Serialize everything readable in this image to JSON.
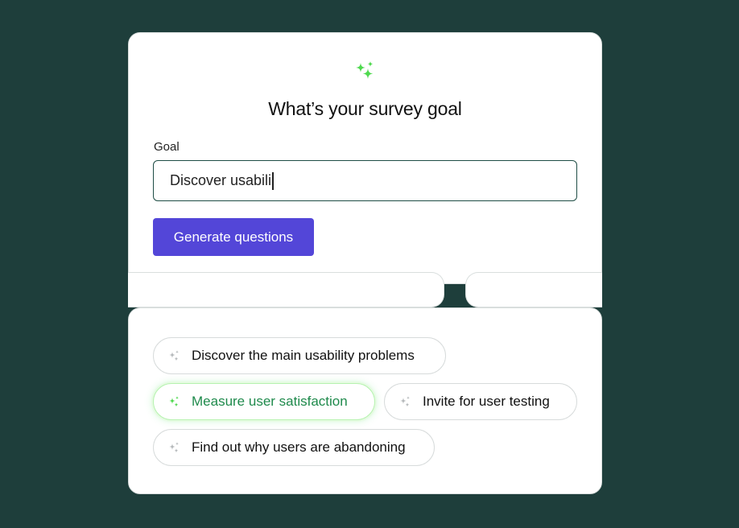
{
  "goal_card": {
    "icon": "sparkles-icon",
    "title": "What’s your survey goal",
    "field_label": "Goal",
    "input_value": "Discover usabili",
    "generate_button": "Generate questions"
  },
  "suggestions": {
    "items": [
      {
        "label": "Discover the main usability problems",
        "icon": "sparkle-icon",
        "active": false
      },
      {
        "label": "Measure user satisfaction",
        "icon": "sparkle-icon",
        "active": true
      },
      {
        "label": "Invite for user testing",
        "icon": "sparkle-icon",
        "active": false
      },
      {
        "label": "Find out why users are abandoning",
        "icon": "sparkle-icon",
        "active": false
      }
    ]
  },
  "colors": {
    "background": "#1e3e3b",
    "primary_button": "#5346d8",
    "accent_green": "#4ed94e",
    "active_text": "#1f8a4c",
    "input_border": "#1f4d45"
  }
}
